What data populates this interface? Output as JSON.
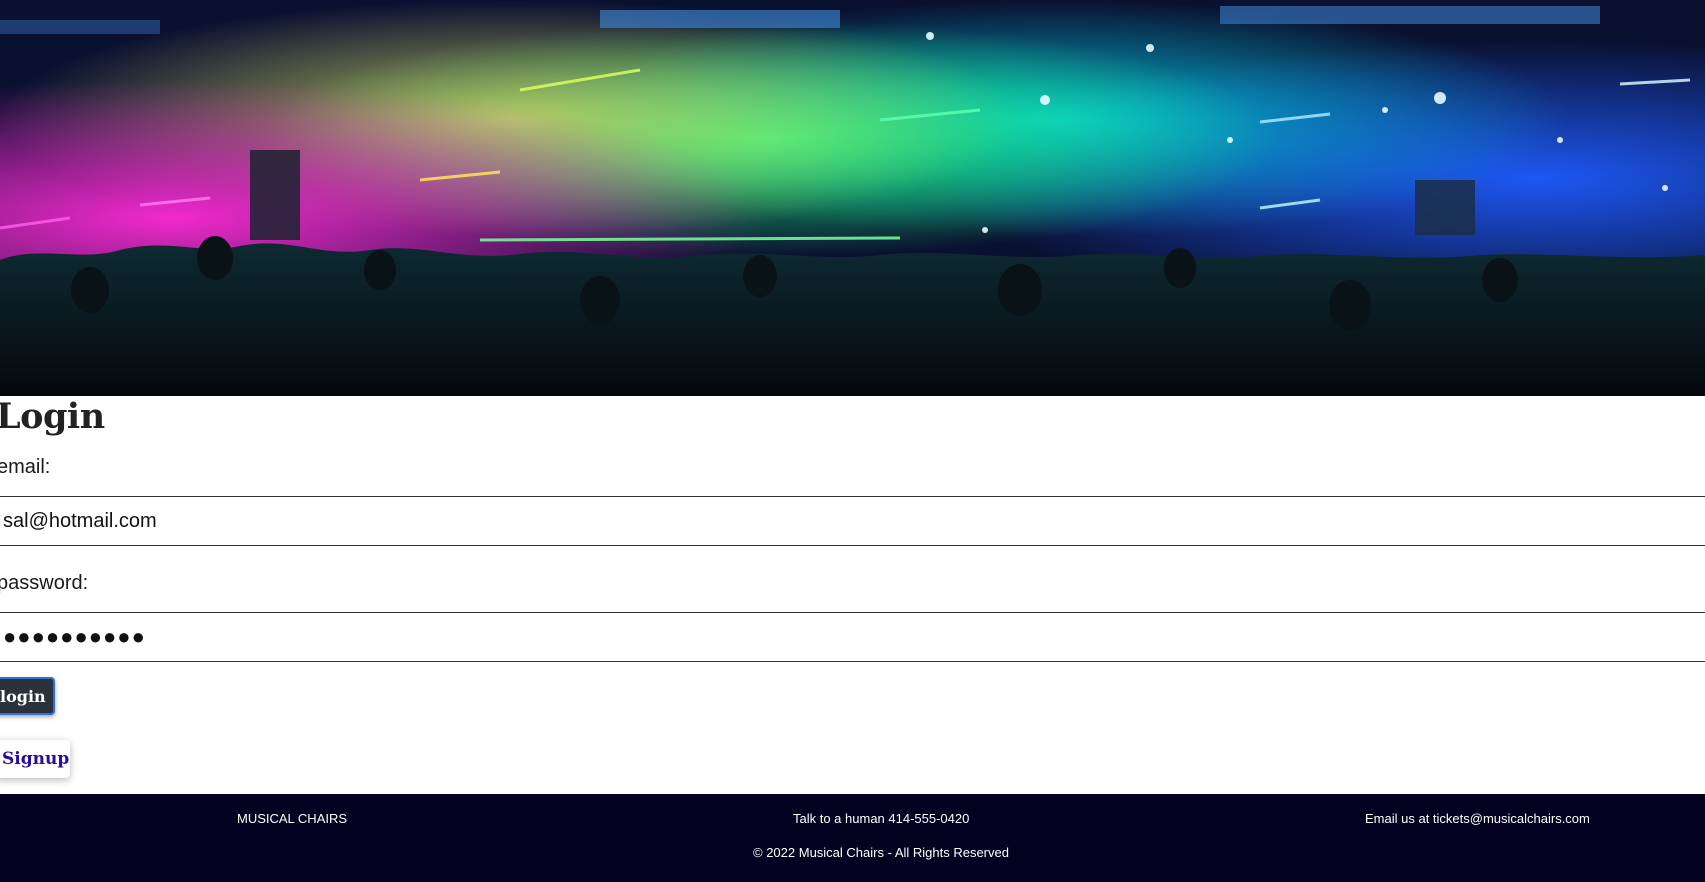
{
  "login": {
    "title": "Login",
    "email_label": "email:",
    "email_value": "sal@hotmail.com",
    "password_label": "password:",
    "password_value": "●●●●●●●●●●",
    "login_button": "login",
    "signup_button": "Signup"
  },
  "footer": {
    "brand": "MUSICAL CHAIRS",
    "phone": "Talk to a human 414-555-0420",
    "email": "Email us at tickets@musicalchairs.com",
    "copyright": "© 2022 Musical Chairs - All Rights Reserved"
  },
  "colors": {
    "footer_bg": "#03011f",
    "signup_text": "#2a0aa0",
    "login_button_bg": "#2b323c",
    "login_button_border": "#2f6fe0"
  }
}
